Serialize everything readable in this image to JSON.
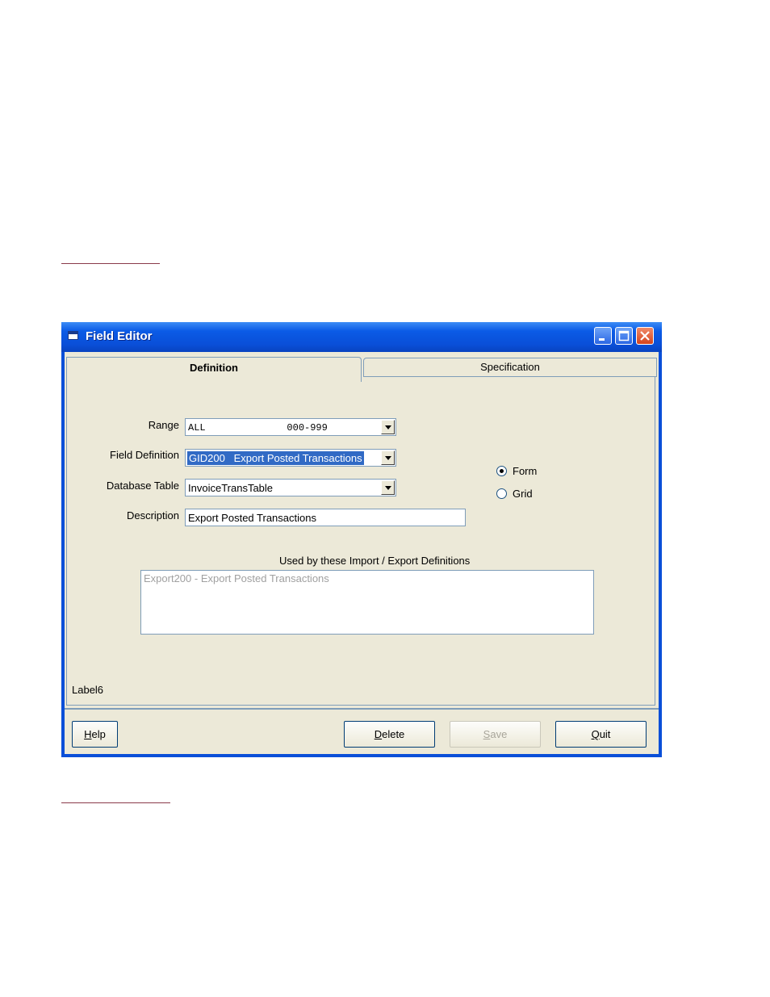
{
  "window": {
    "title": "Field Editor"
  },
  "tabs": [
    {
      "label": "Definition",
      "active": true
    },
    {
      "label": "Specification",
      "active": false
    }
  ],
  "form": {
    "range_label": "Range",
    "range_value": "ALL              000-999",
    "field_definition_label": "Field Definition",
    "field_definition_value": "GID200   Export Posted Transactions",
    "database_table_label": "Database Table",
    "database_table_value": "InvoiceTransTable",
    "description_label": "Description",
    "description_value": "Export Posted Transactions"
  },
  "view_options": [
    {
      "label": "Form",
      "selected": true
    },
    {
      "label": "Grid",
      "selected": false
    }
  ],
  "used_by": {
    "title": "Used by these Import / Export Definitions",
    "items": [
      "Export200 - Export Posted Transactions"
    ]
  },
  "status_label": "Label6",
  "buttons": {
    "help": {
      "first": "H",
      "rest": "elp"
    },
    "delete": {
      "first": "D",
      "rest": "elete"
    },
    "save": {
      "first": "S",
      "rest": "ave"
    },
    "quit": {
      "first": "Q",
      "rest": "uit"
    }
  },
  "colors": {
    "titlebar": "#0a4fd8",
    "client_bg": "#ece9d8",
    "close_button": "#d5431c",
    "selection": "#316ac5"
  }
}
